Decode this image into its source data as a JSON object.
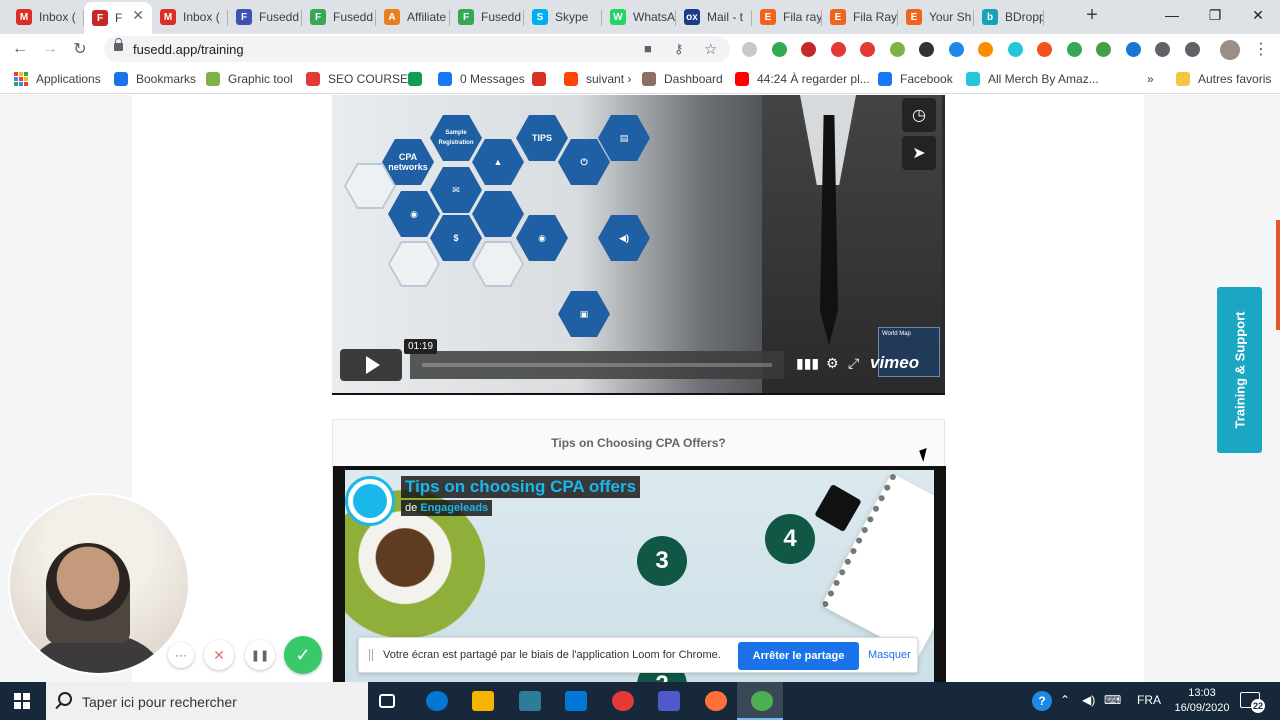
{
  "tabs": [
    {
      "label": "Inbox (",
      "color": "#d93025",
      "glyph": "M"
    },
    {
      "label": "F",
      "color": "#c62828",
      "glyph": "F",
      "active": true
    },
    {
      "label": "Inbox (",
      "color": "#d93025",
      "glyph": "M"
    },
    {
      "label": "Fusedd",
      "color": "#3f51b5",
      "glyph": "F"
    },
    {
      "label": "Fusedd",
      "color": "#34a853",
      "glyph": "F"
    },
    {
      "label": "Affiliate",
      "color": "#e67e22",
      "glyph": "A"
    },
    {
      "label": "Fusedd",
      "color": "#34a853",
      "glyph": "F"
    },
    {
      "label": "Skype",
      "color": "#00aff0",
      "glyph": "S"
    },
    {
      "label": "WhatsA",
      "color": "#25d366",
      "glyph": "W"
    },
    {
      "label": "Mail - t",
      "color": "#1e3a8a",
      "glyph": "ox"
    },
    {
      "label": "Fila ray",
      "color": "#f1641e",
      "glyph": "E"
    },
    {
      "label": "Fila Ray",
      "color": "#f1641e",
      "glyph": "E"
    },
    {
      "label": "Your Sh",
      "color": "#f1641e",
      "glyph": "E"
    },
    {
      "label": "BDropp",
      "color": "#17a2b8",
      "glyph": "b"
    }
  ],
  "toolbar": {
    "url": "fusedd.app/training",
    "back_glyph": "←",
    "forward_glyph": "→",
    "reload_glyph": "↻",
    "camera_glyph": "■",
    "key_glyph": "⚷",
    "star_glyph": "☆",
    "menu_glyph": "⋮",
    "new_tab_glyph": "+",
    "minimize_glyph": "—",
    "maximize_glyph": "❐",
    "close_glyph": "✕",
    "extension_colors": [
      "#c8c8c8",
      "#34a853",
      "#c62828",
      "#e53935",
      "#e53935",
      "#7cb342",
      "#333333",
      "#1e88e5",
      "#fb8c00",
      "#26c6da",
      "#f4511e",
      "#34a853",
      "#43a047",
      "#1976d2",
      "#5f6368",
      "#5f6368"
    ]
  },
  "bookmarks": {
    "items": [
      {
        "label": "Applications",
        "icon": "apps-grid"
      },
      {
        "label": "Bookmarks",
        "color": "#1a73e8",
        "icon": "star-icon"
      },
      {
        "label": "Graphic tool",
        "color": "#7cb342",
        "icon": "graphic-tool-icon"
      },
      {
        "label": "SEO COURSE",
        "color": "#e53935",
        "icon": "seo-icon"
      },
      {
        "label": "",
        "color": "#0f9d58",
        "icon": "grammarly-icon"
      },
      {
        "label": "0 Messages",
        "color": "#1877f2",
        "icon": "facebook-icon"
      },
      {
        "label": "",
        "color": "#d93025",
        "icon": "gmail-icon"
      },
      {
        "label": "suivant ›",
        "color": "#ff4500",
        "icon": "reddit-icon"
      },
      {
        "label": "Dashboard",
        "color": "#8d6e63",
        "icon": "dashboard-icon"
      },
      {
        "label": "44:24 À regarder pl...",
        "color": "#ff0000",
        "icon": "youtube-icon"
      },
      {
        "label": "Facebook",
        "color": "#1877f2",
        "icon": "facebook-icon"
      },
      {
        "label": "All Merch By Amaz...",
        "color": "#26c6da",
        "icon": "merch-icon"
      }
    ],
    "overflow": "»",
    "other": "Autres favoris"
  },
  "video1": {
    "timestamp": "01:19",
    "brand": "vimeo",
    "hex_labels": [
      "CPA networks",
      "Sample Registration",
      "TIPS"
    ],
    "world_map": "World Map",
    "author": "de Engageleads"
  },
  "video2_card": {
    "heading": "Tips on Choosing CPA Offers?",
    "video_title": "Tips on choosing CPA offers",
    "by_prefix": "de",
    "author": "Engageleads",
    "steps": [
      "3",
      "4",
      "2"
    ]
  },
  "loom": {
    "message": "Votre écran est partagé par le biais de l'application Loom for Chrome.",
    "stop_label": "Arrêter le partage",
    "hide_label": "Masquer",
    "more_glyph": "···",
    "cancel_glyph": "✕",
    "pause_glyph": "❚❚",
    "done_glyph": "✓"
  },
  "support_tab": "Training & Support",
  "taskbar": {
    "search_placeholder": "Taper ici pour rechercher",
    "lang": "FRA",
    "time": "13:03",
    "date": "16/09/2020",
    "notifications": "22",
    "app_colors": [
      "#ffffff",
      "#0078d4",
      "#f4b400",
      "#2d7d9a",
      "#0078d4",
      "#e53935",
      "#5059c9",
      "#ff7139",
      "#4caf50"
    ]
  }
}
